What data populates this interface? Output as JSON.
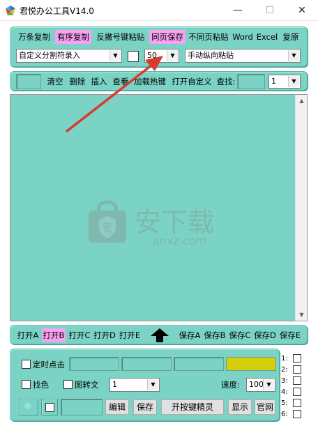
{
  "window": {
    "title": "君悦办公工具V14.0",
    "min_glyph": "—",
    "max_glyph": "☐",
    "close_glyph": "✕"
  },
  "toolbar1": {
    "buttons": [
      "万条复制",
      "有序复制",
      "反撇号键粘贴",
      "同页保存",
      "不同页粘贴",
      "Word",
      "Excel",
      "复原"
    ],
    "separator_combo": "自定义分割符录入",
    "num_combo": "50",
    "paste_mode_combo": "手动纵向粘贴"
  },
  "toolbar2": {
    "buttons": [
      "清空",
      "删除",
      "插入",
      "查看",
      "加载热键",
      "打开自定义",
      "查找:"
    ],
    "page_combo": "1"
  },
  "toolbar3": {
    "open_buttons": [
      "打开A",
      "打开B",
      "打开C",
      "打开D",
      "打开E"
    ],
    "save_buttons": [
      "保存A",
      "保存B",
      "保存C",
      "保存D",
      "保存E"
    ],
    "arrow_icon": "up-arrow-icon"
  },
  "bottom": {
    "timer_click": "定时点击",
    "find_color": "找色",
    "image_to_text": "图转文",
    "index_combo": "1",
    "speed_label": "速度:",
    "speed_combo": "100",
    "edit": "编辑",
    "save": "保存",
    "open_sprite": "开按键精灵",
    "show": "显示",
    "website": "官网",
    "side_checks": [
      "1:",
      "2:",
      "3:",
      "4:",
      "5:",
      "6:"
    ]
  },
  "watermark": {
    "text_cn": "安下载",
    "text_en": "anxz.com"
  },
  "colors": {
    "panel": "#7bd3c5",
    "pink_highlight": "#f7a1f1",
    "yellow_box": "#d4cf0a",
    "arrow_annotation": "#d83a2e"
  }
}
